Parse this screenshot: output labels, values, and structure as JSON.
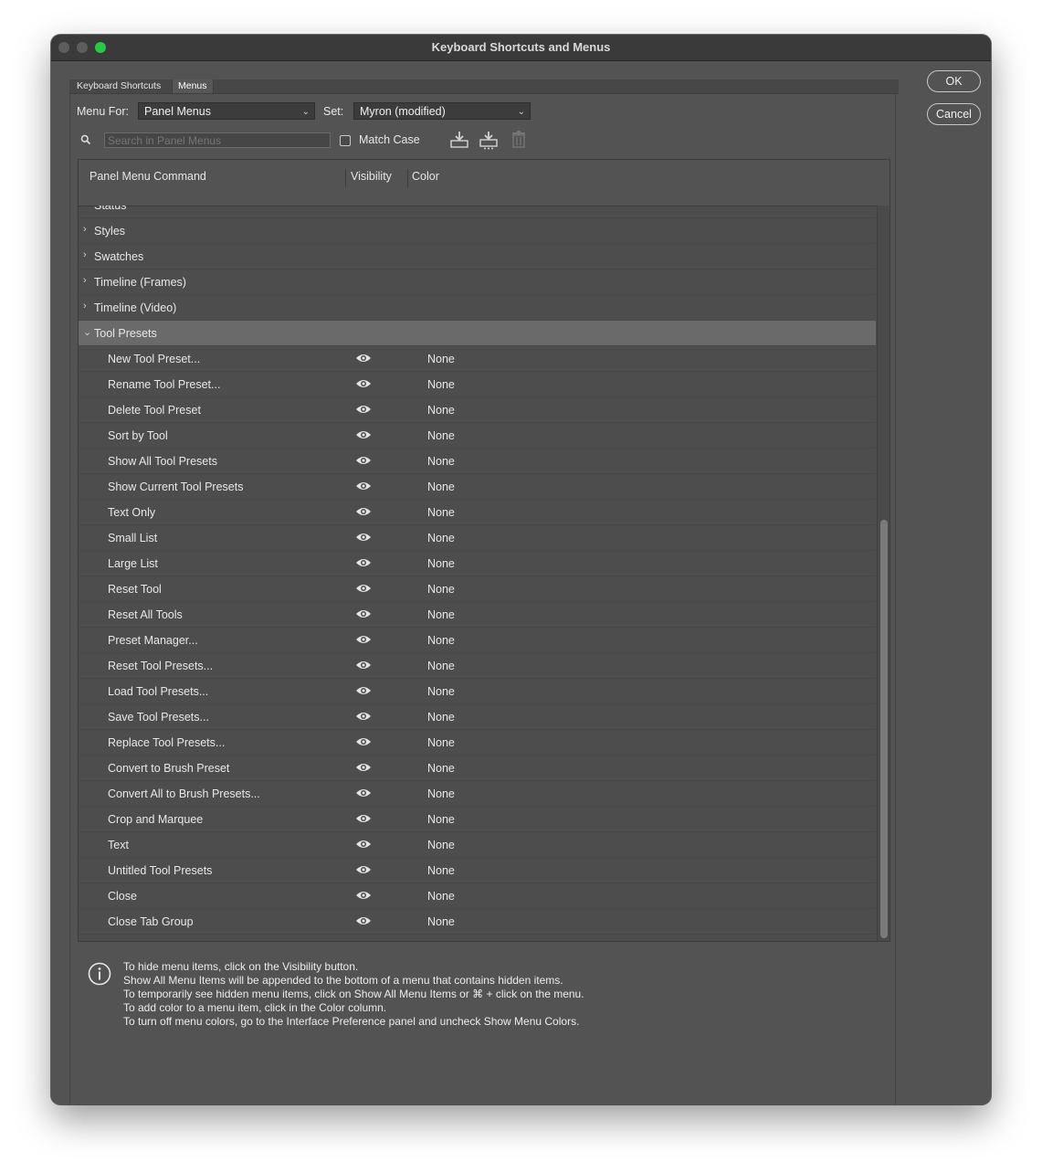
{
  "window": {
    "title": "Keyboard Shortcuts and Menus"
  },
  "tabs": [
    {
      "label": "Keyboard Shortcuts",
      "active": false
    },
    {
      "label": "Menus",
      "active": true
    }
  ],
  "buttons": {
    "ok": "OK",
    "cancel": "Cancel"
  },
  "controls": {
    "menu_for_label": "Menu For:",
    "menu_for_value": "Panel Menus",
    "set_label": "Set:",
    "set_value": "Myron (modified)",
    "search_placeholder": "Search in Panel Menus",
    "match_case_label": "Match Case",
    "match_case_checked": false
  },
  "icons": {
    "search": "search-icon",
    "save_set": "save-set-icon",
    "save_set_as": "save-set-as-icon",
    "delete_set": "trash-icon",
    "visibility": "eye-icon",
    "info": "info-icon"
  },
  "table": {
    "headers": {
      "command": "Panel Menu Command",
      "visibility": "Visibility",
      "color": "Color"
    },
    "groups_collapsed": [
      "Status",
      "Styles",
      "Swatches",
      "Timeline (Frames)",
      "Timeline (Video)"
    ],
    "expanded_group": "Tool Presets",
    "commands": [
      {
        "name": "New Tool Preset...",
        "visible": true,
        "color": "None"
      },
      {
        "name": "Rename Tool Preset...",
        "visible": true,
        "color": "None"
      },
      {
        "name": "Delete Tool Preset",
        "visible": true,
        "color": "None"
      },
      {
        "name": "Sort by Tool",
        "visible": true,
        "color": "None"
      },
      {
        "name": "Show All Tool Presets",
        "visible": true,
        "color": "None"
      },
      {
        "name": "Show Current Tool Presets",
        "visible": true,
        "color": "None"
      },
      {
        "name": "Text Only",
        "visible": true,
        "color": "None"
      },
      {
        "name": "Small List",
        "visible": true,
        "color": "None"
      },
      {
        "name": "Large List",
        "visible": true,
        "color": "None"
      },
      {
        "name": "Reset Tool",
        "visible": true,
        "color": "None"
      },
      {
        "name": "Reset All Tools",
        "visible": true,
        "color": "None"
      },
      {
        "name": "Preset Manager...",
        "visible": true,
        "color": "None"
      },
      {
        "name": "Reset Tool Presets...",
        "visible": true,
        "color": "None"
      },
      {
        "name": "Load Tool Presets...",
        "visible": true,
        "color": "None"
      },
      {
        "name": "Save Tool Presets...",
        "visible": true,
        "color": "None"
      },
      {
        "name": "Replace Tool Presets...",
        "visible": true,
        "color": "None"
      },
      {
        "name": "Convert to Brush Preset",
        "visible": true,
        "color": "None"
      },
      {
        "name": "Convert All to Brush Presets...",
        "visible": true,
        "color": "None"
      },
      {
        "name": "Crop and Marquee",
        "visible": true,
        "color": "None"
      },
      {
        "name": "Text",
        "visible": true,
        "color": "None"
      },
      {
        "name": "Untitled Tool Presets",
        "visible": true,
        "color": "None"
      },
      {
        "name": "Close",
        "visible": true,
        "color": "None"
      },
      {
        "name": "Close Tab Group",
        "visible": true,
        "color": "None"
      }
    ]
  },
  "info_lines": [
    "To hide menu items, click on the Visibility button.",
    "Show All Menu Items will be appended to the bottom of a menu that contains hidden items.",
    "To temporarily see hidden menu items, click on Show All Menu Items or ⌘ + click on the menu.",
    "To add color to a menu item, click in the Color column.",
    "To turn off menu colors, go to the Interface Preference panel and uncheck Show Menu Colors."
  ],
  "colors": {
    "window_bg": "#535353",
    "titlebar": "#3a3a3a",
    "expanded_row": "#6a6a6a",
    "close_light": "#5d5d5d",
    "zoom_light": "#27c93f"
  }
}
